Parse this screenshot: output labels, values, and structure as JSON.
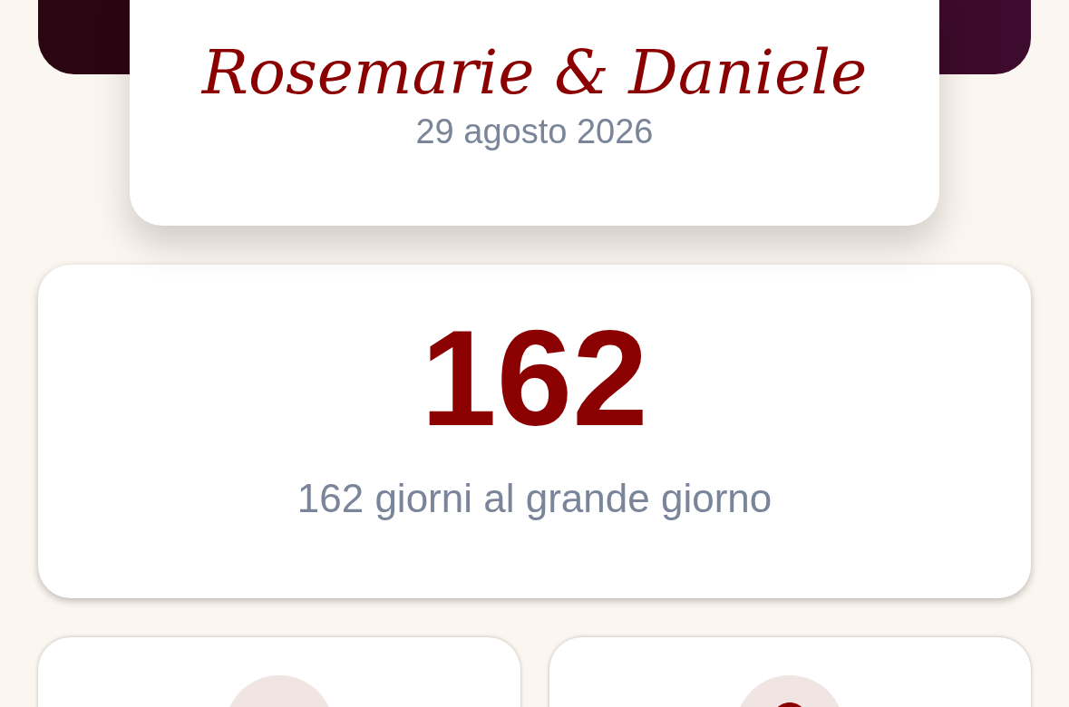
{
  "couple": {
    "names": "Rosemarie & Daniele",
    "date": "29 agosto 2026"
  },
  "countdown": {
    "days": "162",
    "caption": "162 giorni al grande giorno"
  }
}
